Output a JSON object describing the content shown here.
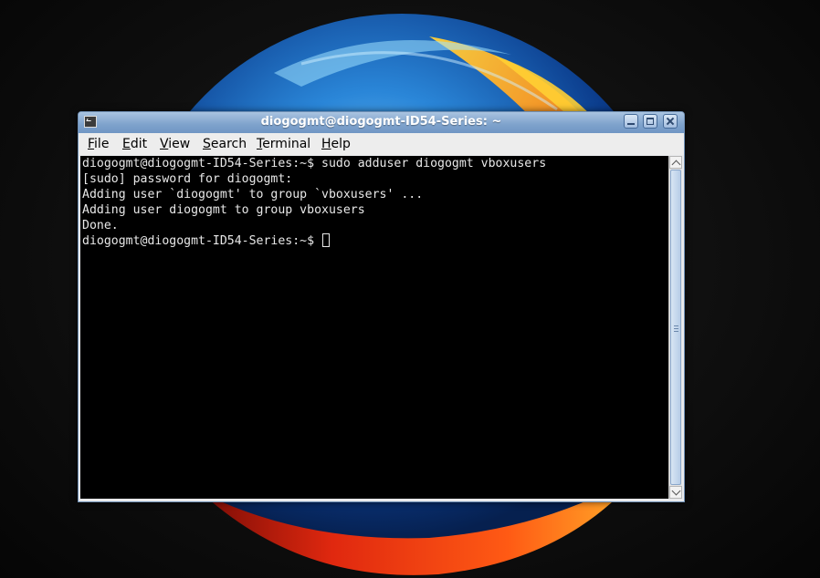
{
  "window": {
    "title": "diogogmt@diogogmt-ID54-Series: ~"
  },
  "menubar": {
    "items": [
      {
        "accel": "F",
        "rest": "ile"
      },
      {
        "accel": "E",
        "rest": "dit"
      },
      {
        "accel": "V",
        "rest": "iew"
      },
      {
        "accel": "S",
        "rest": "earch"
      },
      {
        "accel": "T",
        "rest": "erminal"
      },
      {
        "accel": "H",
        "rest": "elp"
      }
    ]
  },
  "terminal": {
    "lines": [
      "diogogmt@diogogmt-ID54-Series:~$ sudo adduser diogogmt vboxusers",
      "[sudo] password for diogogmt:",
      "Adding user `diogogmt' to group `vboxusers' ...",
      "Adding user diogogmt to group vboxusers",
      "Done."
    ],
    "prompt": "diogogmt@diogogmt-ID54-Series:~$ "
  },
  "colors": {
    "titlebar": "#7ea2cc",
    "terminal_bg": "#000000",
    "terminal_fg": "#e8e8e8",
    "menubar_bg": "#ededed"
  }
}
